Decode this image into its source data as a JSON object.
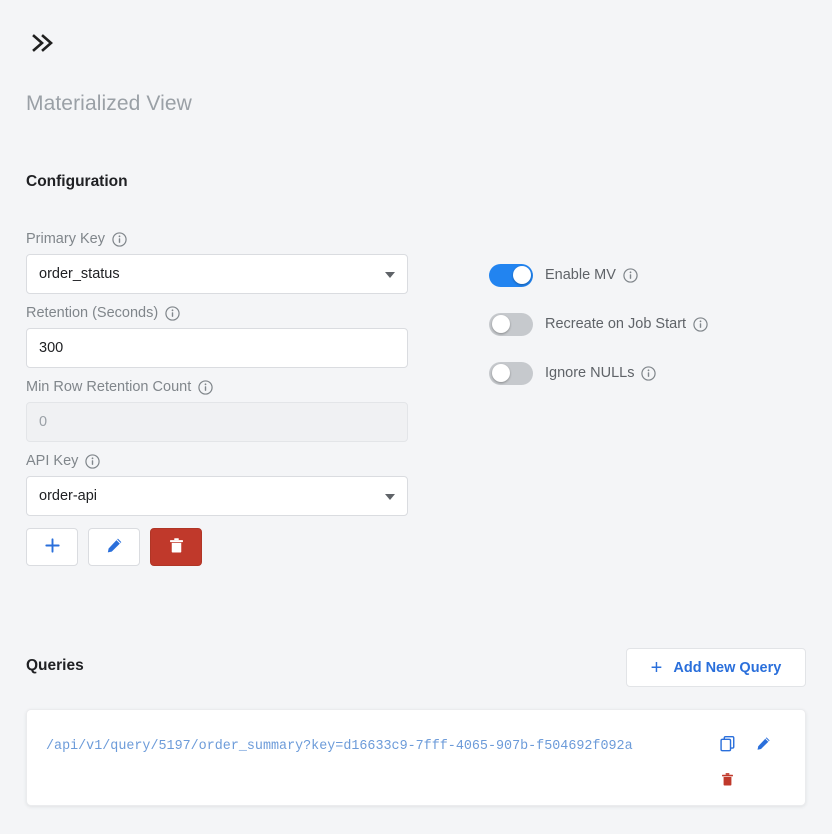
{
  "header": {
    "collapse_icon": "double-chevron-right-icon",
    "view_title": "Materialized View"
  },
  "configuration": {
    "section_title": "Configuration",
    "fields": [
      {
        "label": "Primary Key",
        "info_icon": "info-icon",
        "type": "select",
        "value": "order_status",
        "disabled": false
      },
      {
        "label": "Retention (Seconds)",
        "info_icon": "info-icon",
        "type": "text",
        "value": "300",
        "disabled": false
      },
      {
        "label": "Min Row Retention Count",
        "info_icon": "info-icon",
        "type": "text",
        "value": "0",
        "disabled": true
      },
      {
        "label": "API Key",
        "info_icon": "info-icon",
        "type": "select",
        "value": "order-api",
        "disabled": false
      }
    ],
    "key_actions": [
      {
        "name": "add-api-key-button",
        "icon": "plus-icon"
      },
      {
        "name": "edit-api-key-button",
        "icon": "pencil-icon"
      },
      {
        "name": "delete-api-key-button",
        "icon": "trash-icon"
      }
    ],
    "toggles": [
      {
        "label": "Enable MV",
        "on": true,
        "info_icon": "info-icon"
      },
      {
        "label": "Recreate on Job Start",
        "on": false,
        "info_icon": "info-icon"
      },
      {
        "label": "Ignore NULLs",
        "on": false,
        "info_icon": "info-icon"
      }
    ]
  },
  "queries": {
    "section_title": "Queries",
    "add_button_label": "Add New Query",
    "add_button_icon": "plus-icon",
    "items": [
      {
        "url": "/api/v1/query/5197/order_summary?key=d16633c9-7fff-4065-907b-f504692f092a",
        "actions": [
          {
            "name": "copy-query-button",
            "icon": "copy-icon"
          },
          {
            "name": "edit-query-button",
            "icon": "pencil-icon"
          },
          {
            "name": "delete-query-button",
            "icon": "trash-icon"
          }
        ]
      }
    ]
  },
  "colors": {
    "background": "#f4f5f7",
    "accent_blue": "#2284f0",
    "link_blue": "#2a6fdb",
    "danger_red": "#c0392b",
    "url_text": "#6c9bd9"
  }
}
